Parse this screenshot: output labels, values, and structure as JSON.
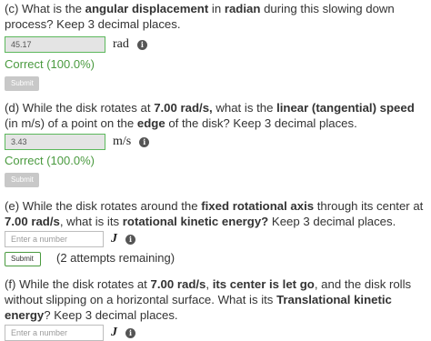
{
  "part_c": {
    "q_prefix": "(c) What is the ",
    "q_bold1": "angular displacement",
    "q_mid1": " in ",
    "q_bold2": "radian",
    "q_suffix": " during this slowing down process? Keep 3 decimal places.",
    "answer_value": "45.17",
    "unit": "rad",
    "correct_text": "Correct (100.0%)",
    "submit_label": "Submit"
  },
  "part_d": {
    "q_prefix": "(d) While the disk rotates at ",
    "q_bold1": "7.00 rad/s,",
    "q_mid1": " what is the ",
    "q_bold2": "linear (tangential) speed",
    "q_mid2": " (in m/s) of a point on the ",
    "q_bold3": "edge",
    "q_suffix": " of the disk?  Keep 3 decimal places.",
    "answer_value": "3.43",
    "unit": "m/s",
    "correct_text": "Correct (100.0%)",
    "submit_label": "Submit"
  },
  "part_e": {
    "q_prefix": "(e) While the disk rotates around the ",
    "q_bold1": "fixed rotational axis",
    "q_mid1": " through its center at ",
    "q_bold2": "7.00 rad/s",
    "q_mid2": ",  what is its ",
    "q_bold3": "rotational kinetic energy?",
    "q_suffix": "  Keep 3 decimal places.",
    "placeholder": "Enter a number",
    "unit": "J",
    "submit_label": "Submit",
    "attempts_text": "(2 attempts remaining)"
  },
  "part_f": {
    "q_prefix": "(f) While the disk rotates at ",
    "q_bold1": "7.00 rad/s",
    "q_mid1": ",  ",
    "q_bold2": "its center is let go",
    "q_mid2": ", and the disk rolls without slipping on a horizontal surface. What is its ",
    "q_bold3": "Translational  kinetic energy",
    "q_suffix": "? Keep 3 decimal places.",
    "placeholder": "Enter a number",
    "unit": "J"
  },
  "icons": {
    "info": "info-circle-icon"
  },
  "colors": {
    "correct_green": "#4a9a3f",
    "correct_border": "#5cb85c",
    "disabled_button": "#c8c8c8"
  }
}
